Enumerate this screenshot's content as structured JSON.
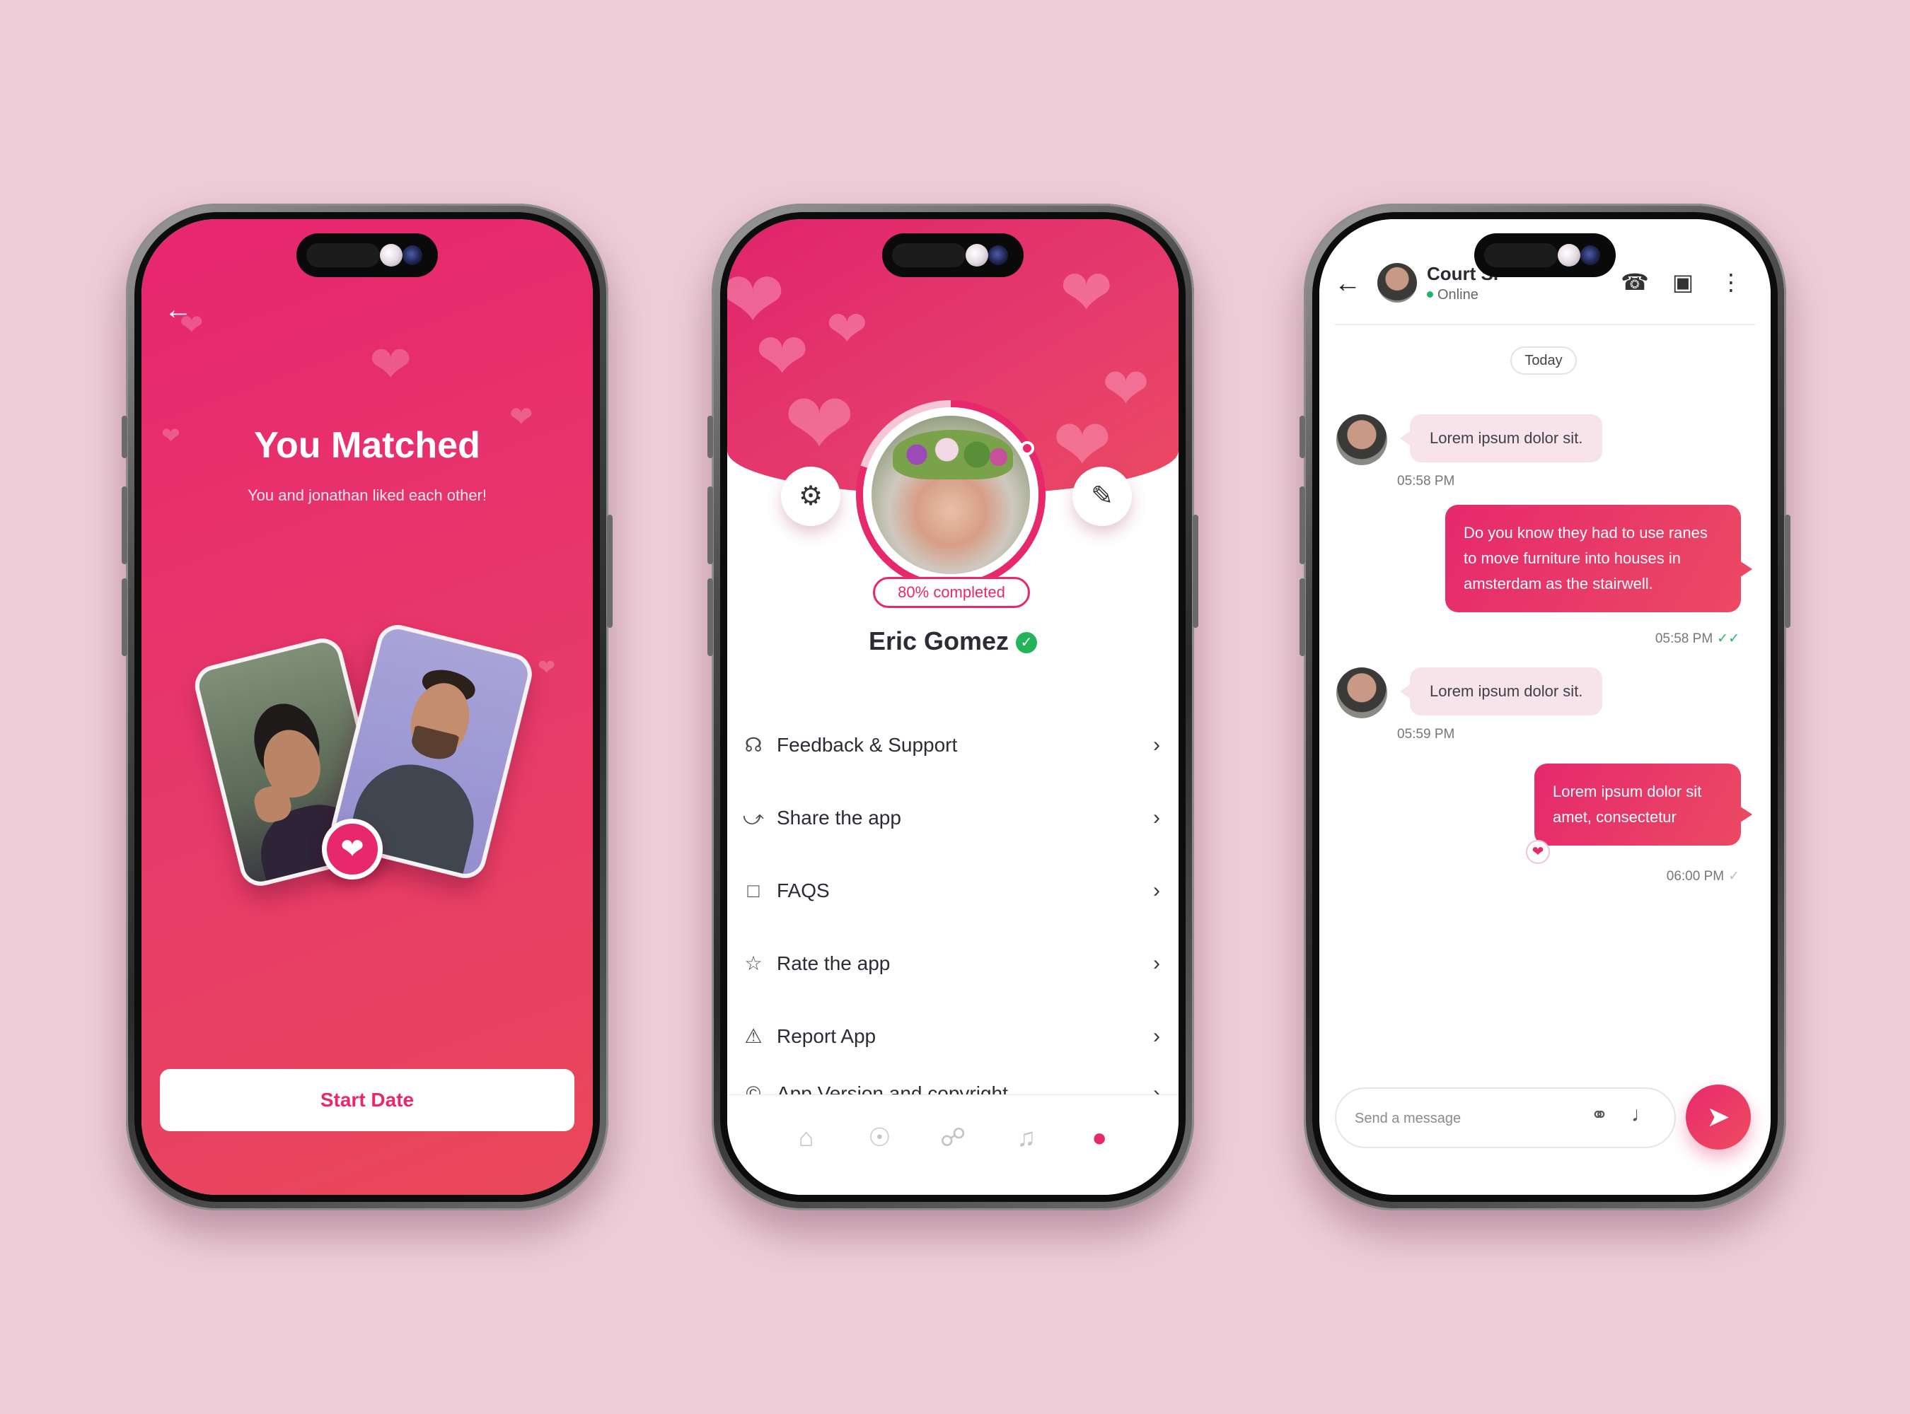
{
  "match_screen": {
    "back_icon": "arrow-left-icon",
    "title": "You Matched",
    "subtitle": "You and jonathan liked each other!",
    "heart_badge_icon": "heart-icon",
    "start_button": "Start Date",
    "colors": {
      "gradient_start": "#e7266e",
      "gradient_end": "#e9485a",
      "accent": "#e8286c"
    }
  },
  "profile_screen": {
    "settings_icon": "gear-icon",
    "edit_icon": "pencil-icon",
    "completion_badge": "80% completed",
    "profile_completion": 0.8,
    "name": "Eric Gomez",
    "verified_icon": "verified-check-icon",
    "menu": [
      {
        "label": "Feedback & Support",
        "icon": "headphones-icon"
      },
      {
        "label": "Share the app",
        "icon": "share-icon"
      },
      {
        "label": "FAQS",
        "icon": "question-bubble-icon"
      },
      {
        "label": "Rate the app",
        "icon": "star-icon"
      },
      {
        "label": "Report App",
        "icon": "report-icon"
      },
      {
        "label": "App Version and copyright",
        "icon": "copyright-icon"
      }
    ],
    "nav": [
      {
        "icon": "home-icon",
        "active": false
      },
      {
        "icon": "compass-icon",
        "active": false
      },
      {
        "icon": "chat-icon",
        "active": false
      },
      {
        "icon": "bell-icon",
        "active": false
      },
      {
        "icon": "profile-icon",
        "active": true
      }
    ]
  },
  "chat_screen": {
    "contact_name": "Court S.",
    "contact_status": "Online",
    "header_icons": [
      "phone-icon",
      "video-icon",
      "more-vertical-icon"
    ],
    "date_chip": "Today",
    "messages": [
      {
        "direction": "in",
        "text": "Lorem ipsum dolor sit.",
        "time": "05:58 PM"
      },
      {
        "direction": "out",
        "lines": [
          "Do you know they had to use ranes",
          "to move furniture into houses in",
          "amsterdam as the stairwell."
        ],
        "time": "05:58 PM",
        "read": true
      },
      {
        "direction": "in",
        "text": "Lorem ipsum dolor sit.",
        "time": "05:59 PM"
      },
      {
        "direction": "out",
        "lines": [
          "Lorem ipsum dolor sit",
          "amet, consectetur"
        ],
        "time": "06:00 PM",
        "read": false,
        "reaction": "heart-icon"
      }
    ],
    "composer_placeholder": "Send a message",
    "composer_icons": [
      "attachment-icon",
      "microphone-icon"
    ],
    "send_icon": "send-icon"
  }
}
